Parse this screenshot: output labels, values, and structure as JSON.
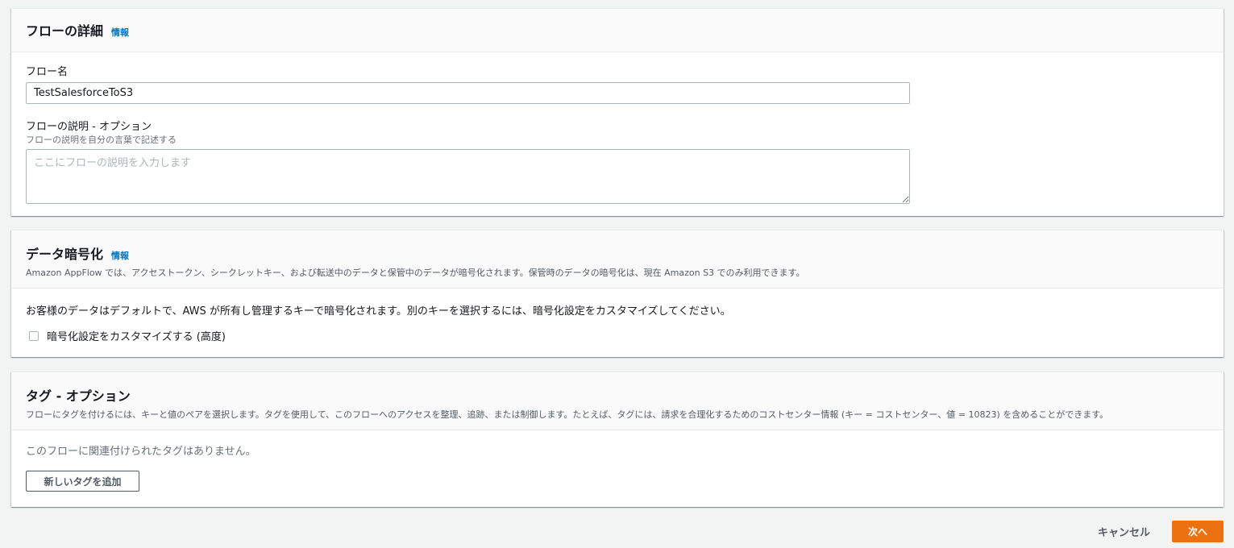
{
  "flow_details": {
    "title": "フローの詳細",
    "info_link": "情報",
    "name_label": "フロー名",
    "name_value": "TestSalesforceToS3",
    "desc_label": "フローの説明 - オプション",
    "desc_sublabel": "フローの説明を自分の言葉で記述する",
    "desc_placeholder": "ここにフローの説明を入力します",
    "desc_value": ""
  },
  "encryption": {
    "title": "データ暗号化",
    "info_link": "情報",
    "description": "Amazon AppFlow では、アクセストークン、シークレットキー、および転送中のデータと保管中のデータが暗号化されます。保管時のデータの暗号化は、現在 Amazon S3 でのみ利用できます。",
    "body_text": "お客様のデータはデフォルトで、AWS が所有し管理するキーで暗号化されます。別のキーを選択するには、暗号化設定をカスタマイズしてください。",
    "checkbox_label": "暗号化設定をカスタマイズする (高度)",
    "checkbox_checked": false
  },
  "tags": {
    "title": "タグ - オプション",
    "description": "フローにタグを付けるには、キーと値のペアを選択します。タグを使用して、このフローへのアクセスを整理、追跡、または制御します。たとえば、タグには、請求を合理化するためのコストセンター情報 (キー = コストセンター、値 = 10823) を含めることができます。",
    "empty_text": "このフローに関連付けられたタグはありません。",
    "add_button": "新しいタグを追加"
  },
  "footer": {
    "cancel_label": "キャンセル",
    "next_label": "次へ"
  },
  "colors": {
    "primary": "#ec7211",
    "link": "#0073bb",
    "background": "#f2f3f3"
  }
}
